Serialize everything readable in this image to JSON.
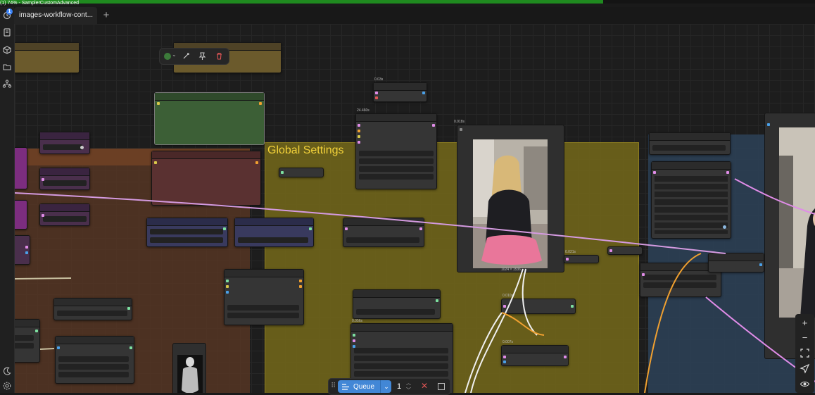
{
  "app": {
    "progress_percent": 74,
    "status_text": "(1) 74% - SamplerCustomAdvanced",
    "badge_count": "1"
  },
  "tabs": [
    {
      "label": "images-workflow-cont...",
      "active": true
    }
  ],
  "tab_add_icon": "plus-icon",
  "sidebar": {
    "icons": [
      "queue-icon",
      "library-icon",
      "models-icon",
      "workflows-icon",
      "templates-icon",
      "theme-icon",
      "settings-icon"
    ]
  },
  "canvas": {
    "groups": {
      "global_settings_title": "Global Settings",
      "left_group_title_fragment": "s)"
    },
    "node_labels": {
      "n1": "0.03s",
      "n2": "24.460s",
      "n3": "0.018s",
      "n4": "0.021s",
      "n5": "0.010s",
      "n6": "0.056s",
      "n7": "0.007s",
      "image_size": "1024 × 1536"
    },
    "colors": {
      "global_group": "#6e631a",
      "left_group": "#4e3223",
      "right_group": "#2b3e52",
      "link_pink": "#e08ce8",
      "link_white": "#f0f0f0",
      "link_orange": "#f0a030",
      "green_node": "#3c5f36",
      "red_node": "#5a3131",
      "blue_node": "#393a5e",
      "accent_queue": "#4287d6"
    }
  },
  "node_toolbar": {
    "icons": [
      "color-picker-icon",
      "bypass-icon",
      "pin-icon",
      "delete-icon"
    ],
    "selected_color": "#3c7a3a"
  },
  "queue_bar": {
    "button_label": "Queue",
    "count": "1",
    "icons": [
      "drag-handle-icon",
      "queue-list-icon",
      "chevron-down-icon",
      "chevron-up-icon",
      "chevron-down-small-icon",
      "cancel-icon",
      "stop-icon"
    ]
  },
  "canvas_controls": {
    "icons": [
      "zoom-in-icon",
      "zoom-out-icon",
      "fit-view-icon",
      "select-mode-icon",
      "toggle-links-icon"
    ]
  }
}
